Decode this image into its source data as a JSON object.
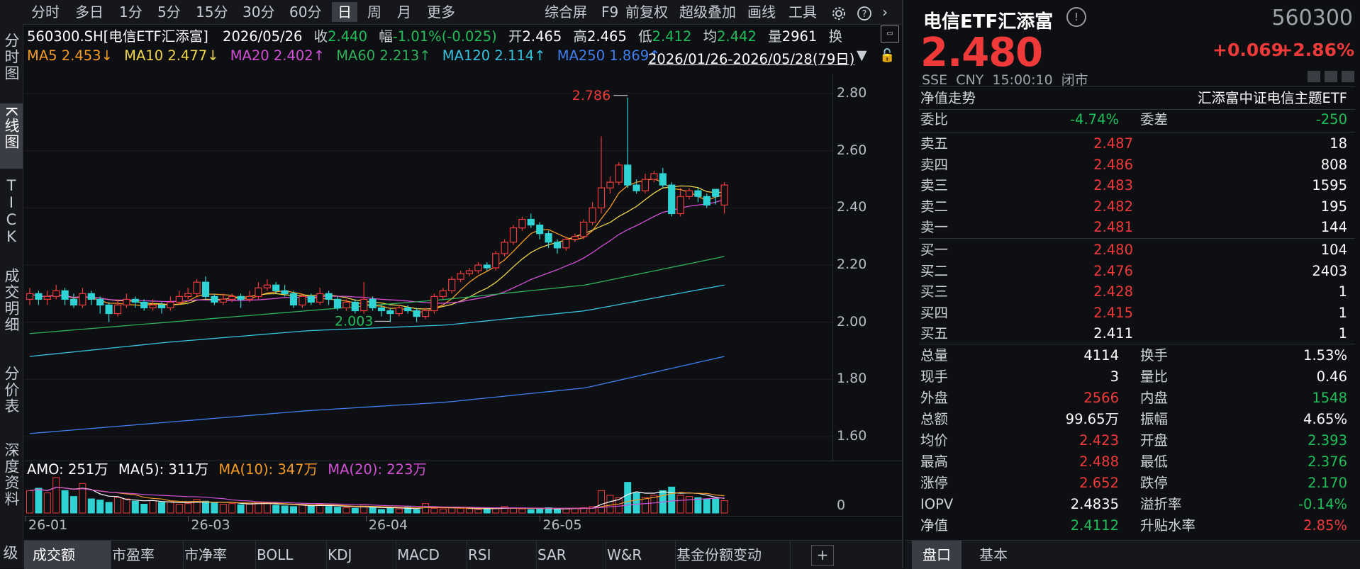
{
  "toolbar": {
    "periods": [
      "分时",
      "多日",
      "1分",
      "5分",
      "15分",
      "30分",
      "60分",
      "日",
      "周",
      "月",
      "更多"
    ],
    "selected": "日",
    "actions": [
      "综合屏",
      "F9",
      "前复权",
      "超级叠加",
      "画线",
      "工具"
    ]
  },
  "left_tabs": [
    "分时图",
    "K线图",
    "TICK",
    "成交明细",
    "分价表",
    "深度资料",
    "超级"
  ],
  "info": {
    "symbol": "560300.SH[电信ETF汇添富]",
    "date": "2026/05/26",
    "close_label": "收",
    "close": "2.440",
    "chg_label": "幅",
    "chg": "-1.01%(-0.025)",
    "open_label": "开",
    "open": "2.465",
    "high_label": "高",
    "high": "2.465",
    "low_label": "低",
    "low": "2.412",
    "avg_label": "均",
    "avg": "2.442",
    "vol_label": "量",
    "vol": "2961",
    "turn_label": "换"
  },
  "ma": {
    "ma5": "MA5 2.453↓",
    "ma10": "MA10 2.477↓",
    "ma20": "MA20 2.402↑",
    "ma60": "MA60 2.213↑",
    "ma120": "MA120 2.114↑",
    "ma250": "MA250 1.869↑",
    "range": "2026/01/26-2026/05/28(79日)"
  },
  "chart_data": {
    "type": "candlestick",
    "y_ticks": [
      "2.80",
      "2.60",
      "2.40",
      "2.20",
      "2.00",
      "1.80",
      "1.60"
    ],
    "ylim": [
      1.56,
      2.85
    ],
    "x_labels": [
      "26-01",
      "26-03",
      "26-04",
      "26-05"
    ],
    "max_label": "2.786",
    "min_label": "2.003",
    "candles": [
      [
        2.08,
        2.1,
        2.12,
        2.06
      ],
      [
        2.1,
        2.08,
        2.11,
        2.06
      ],
      [
        2.08,
        2.09,
        2.11,
        2.06
      ],
      [
        2.09,
        2.11,
        2.13,
        2.08
      ],
      [
        2.11,
        2.08,
        2.12,
        2.06
      ],
      [
        2.08,
        2.06,
        2.1,
        2.05
      ],
      [
        2.06,
        2.1,
        2.12,
        2.05
      ],
      [
        2.1,
        2.08,
        2.11,
        2.06
      ],
      [
        2.08,
        2.06,
        2.09,
        2.03
      ],
      [
        2.06,
        2.03,
        2.07,
        2.0
      ],
      [
        2.03,
        2.06,
        2.08,
        2.02
      ],
      [
        2.06,
        2.08,
        2.1,
        2.05
      ],
      [
        2.08,
        2.07,
        2.09,
        2.05
      ],
      [
        2.07,
        2.05,
        2.08,
        2.04
      ],
      [
        2.05,
        2.06,
        2.08,
        2.04
      ],
      [
        2.06,
        2.05,
        2.07,
        2.03
      ],
      [
        2.05,
        2.07,
        2.09,
        2.04
      ],
      [
        2.07,
        2.09,
        2.11,
        2.06
      ],
      [
        2.09,
        2.1,
        2.12,
        2.08
      ],
      [
        2.1,
        2.14,
        2.15,
        2.09
      ],
      [
        2.14,
        2.09,
        2.16,
        2.08
      ],
      [
        2.09,
        2.07,
        2.1,
        2.06
      ],
      [
        2.07,
        2.08,
        2.1,
        2.06
      ],
      [
        2.08,
        2.09,
        2.1,
        2.07
      ],
      [
        2.09,
        2.08,
        2.1,
        2.05
      ],
      [
        2.08,
        2.09,
        2.11,
        2.07
      ],
      [
        2.09,
        2.12,
        2.14,
        2.08
      ],
      [
        2.12,
        2.13,
        2.15,
        2.11
      ],
      [
        2.13,
        2.11,
        2.14,
        2.1
      ],
      [
        2.11,
        2.1,
        2.13,
        2.09
      ],
      [
        2.1,
        2.06,
        2.11,
        2.05
      ],
      [
        2.06,
        2.09,
        2.1,
        2.05
      ],
      [
        2.09,
        2.07,
        2.1,
        2.06
      ],
      [
        2.07,
        2.1,
        2.12,
        2.06
      ],
      [
        2.1,
        2.08,
        2.11,
        2.06
      ],
      [
        2.08,
        2.05,
        2.09,
        2.04
      ],
      [
        2.05,
        2.07,
        2.08,
        2.04
      ],
      [
        2.07,
        2.04,
        2.08,
        2.03
      ],
      [
        2.04,
        2.08,
        2.14,
        2.03
      ],
      [
        2.08,
        2.05,
        2.09,
        2.04
      ],
      [
        2.05,
        2.04,
        2.06,
        2.02
      ],
      [
        2.04,
        2.03,
        2.05,
        2.0
      ],
      [
        2.03,
        2.05,
        2.06,
        2.02
      ],
      [
        2.05,
        2.04,
        2.06,
        2.03
      ],
      [
        2.04,
        2.02,
        2.05,
        2.0
      ],
      [
        2.02,
        2.04,
        2.05,
        2.01
      ],
      [
        2.04,
        2.09,
        2.1,
        2.03
      ],
      [
        2.09,
        2.11,
        2.12,
        2.08
      ],
      [
        2.11,
        2.15,
        2.16,
        2.1
      ],
      [
        2.15,
        2.17,
        2.18,
        2.14
      ],
      [
        2.17,
        2.18,
        2.19,
        2.16
      ],
      [
        2.18,
        2.2,
        2.21,
        2.17
      ],
      [
        2.2,
        2.19,
        2.21,
        2.18
      ],
      [
        2.19,
        2.24,
        2.25,
        2.18
      ],
      [
        2.24,
        2.28,
        2.29,
        2.23
      ],
      [
        2.28,
        2.33,
        2.34,
        2.27
      ],
      [
        2.33,
        2.36,
        2.37,
        2.32
      ],
      [
        2.36,
        2.34,
        2.38,
        2.33
      ],
      [
        2.34,
        2.31,
        2.35,
        2.29
      ],
      [
        2.31,
        2.28,
        2.32,
        2.26
      ],
      [
        2.28,
        2.26,
        2.29,
        2.24
      ],
      [
        2.26,
        2.29,
        2.3,
        2.25
      ],
      [
        2.29,
        2.3,
        2.31,
        2.28
      ],
      [
        2.3,
        2.35,
        2.36,
        2.29
      ],
      [
        2.35,
        2.4,
        2.42,
        2.34
      ],
      [
        2.4,
        2.47,
        2.65,
        2.38
      ],
      [
        2.47,
        2.49,
        2.51,
        2.45
      ],
      [
        2.49,
        2.55,
        2.56,
        2.48
      ],
      [
        2.55,
        2.48,
        2.786,
        2.47
      ],
      [
        2.48,
        2.46,
        2.5,
        2.45
      ],
      [
        2.46,
        2.5,
        2.52,
        2.45
      ],
      [
        2.5,
        2.52,
        2.53,
        2.49
      ],
      [
        2.52,
        2.48,
        2.54,
        2.47
      ],
      [
        2.48,
        2.38,
        2.49,
        2.37
      ],
      [
        2.38,
        2.44,
        2.47,
        2.37
      ],
      [
        2.44,
        2.46,
        2.47,
        2.43
      ],
      [
        2.46,
        2.44,
        2.47,
        2.42
      ],
      [
        2.44,
        2.41,
        2.45,
        2.4
      ],
      [
        2.465,
        2.44,
        2.465,
        2.412
      ],
      [
        2.41,
        2.48,
        2.49,
        2.38
      ]
    ],
    "series": [
      {
        "name": "MA5",
        "color": "#f59a23"
      },
      {
        "name": "MA10",
        "color": "#f0d64a"
      },
      {
        "name": "MA20",
        "color": "#d34fd6"
      },
      {
        "name": "MA60",
        "color": "#2fb15b",
        "line": [
          1.96,
          2.0,
          2.04,
          2.08,
          2.13,
          2.23
        ]
      },
      {
        "name": "MA120",
        "color": "#36c3e0",
        "line": [
          1.88,
          1.93,
          1.97,
          1.99,
          2.04,
          2.13
        ]
      },
      {
        "name": "MA250",
        "color": "#3f7ff0",
        "line": [
          1.61,
          1.65,
          1.69,
          1.72,
          1.77,
          1.88
        ]
      }
    ]
  },
  "volume": {
    "amo": "AMO: 251万",
    "ma5": "MA(5): 311万",
    "ma10": "MA(10): 347万",
    "ma20": "MA(20): 223万",
    "zero": "0",
    "values": [
      380,
      420,
      340,
      600,
      380,
      280,
      500,
      240,
      220,
      180,
      260,
      240,
      200,
      150,
      210,
      180,
      190,
      150,
      160,
      230,
      200,
      170,
      150,
      160,
      140,
      150,
      190,
      170,
      130,
      120,
      110,
      140,
      120,
      150,
      110,
      100,
      90,
      80,
      140,
      90,
      60,
      80,
      70,
      100,
      60,
      160,
      80,
      70,
      90,
      80,
      75,
      60,
      70,
      90,
      110,
      80,
      70,
      60,
      80,
      90,
      60,
      70,
      80,
      90,
      110,
      380,
      300,
      260,
      520,
      340,
      260,
      300,
      380,
      440,
      300,
      280,
      260,
      240,
      251,
      210
    ]
  },
  "bottom_tabs": [
    "成交额",
    "市盈率",
    "市净率",
    "BOLL",
    "KDJ",
    "MACD",
    "RSI",
    "SAR",
    "W&R",
    "基金份额变动"
  ],
  "bottom_selected": "成交额",
  "quote": {
    "name": "电信ETF汇添富",
    "code": "560300",
    "price": "2.480",
    "change": "+0.069",
    "pct": "+2.86%",
    "meta": "SSE  CNY  15:00:10  闭市",
    "nav_label": "净值走势",
    "fund_name": "汇添富中证电信主题ETF",
    "weibi_label": "委比",
    "weibi": "-4.74%",
    "weicha_label": "委差",
    "weicha": "-250"
  },
  "orderbook": {
    "sells": [
      {
        "label": "卖五",
        "price": "2.487",
        "qty": "18"
      },
      {
        "label": "卖四",
        "price": "2.486",
        "qty": "808"
      },
      {
        "label": "卖三",
        "price": "2.483",
        "qty": "1595"
      },
      {
        "label": "卖二",
        "price": "2.482",
        "qty": "195"
      },
      {
        "label": "卖一",
        "price": "2.481",
        "qty": "144"
      }
    ],
    "buys": [
      {
        "label": "买一",
        "price": "2.480",
        "qty": "104"
      },
      {
        "label": "买二",
        "price": "2.476",
        "qty": "2403"
      },
      {
        "label": "买三",
        "price": "2.428",
        "qty": "1"
      },
      {
        "label": "买四",
        "price": "2.415",
        "qty": "1"
      },
      {
        "label": "买五",
        "price": "2.411",
        "qty": "1"
      }
    ]
  },
  "stats": [
    {
      "l1": "总量",
      "v1": "4114",
      "c1": "white",
      "l2": "换手",
      "v2": "1.53%",
      "c2": "white"
    },
    {
      "l1": "现手",
      "v1": "3",
      "c1": "white",
      "l2": "量比",
      "v2": "0.46",
      "c2": "white"
    },
    {
      "l1": "外盘",
      "v1": "2566",
      "c1": "red",
      "l2": "内盘",
      "v2": "1548",
      "c2": "green"
    },
    {
      "l1": "总额",
      "v1": "99.65万",
      "c1": "white",
      "l2": "振幅",
      "v2": "4.65%",
      "c2": "white"
    },
    {
      "l1": "均价",
      "v1": "2.423",
      "c1": "red",
      "l2": "开盘",
      "v2": "2.393",
      "c2": "green"
    },
    {
      "l1": "最高",
      "v1": "2.488",
      "c1": "red",
      "l2": "最低",
      "v2": "2.376",
      "c2": "green"
    },
    {
      "l1": "涨停",
      "v1": "2.652",
      "c1": "red",
      "l2": "跌停",
      "v2": "2.170",
      "c2": "green"
    },
    {
      "l1": "IOPV",
      "v1": "2.4835",
      "c1": "white",
      "l2": "溢折率",
      "v2": "-0.14%",
      "c2": "green"
    },
    {
      "l1": "净值",
      "v1": "2.4112",
      "c1": "green",
      "l2": "升贴水率",
      "v2": "2.85%",
      "c2": "red"
    }
  ],
  "right_tabs": [
    "盘口",
    "基本"
  ]
}
